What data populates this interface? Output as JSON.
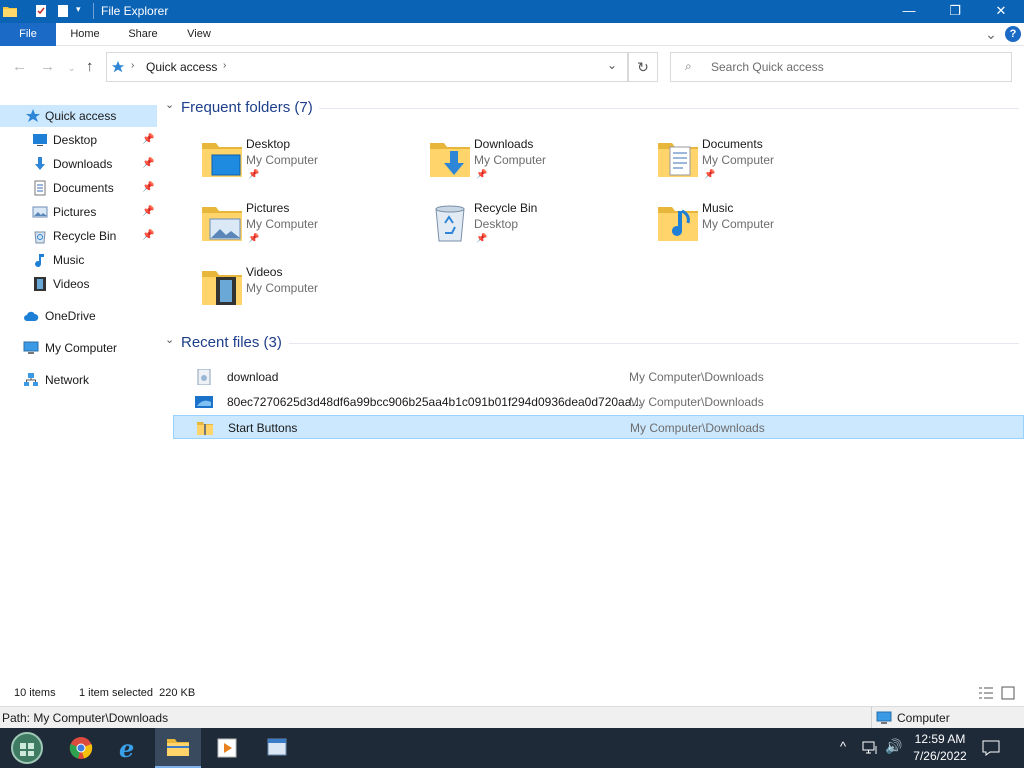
{
  "window": {
    "title": "File Explorer",
    "minimize": "—",
    "maximize": "❐",
    "close": "✕"
  },
  "ribbon": {
    "tabs": [
      "File",
      "Home",
      "Share",
      "View"
    ],
    "expand": "⌄",
    "help": "?"
  },
  "address": {
    "crumb": "Quick access",
    "search_placeholder": "Search Quick access"
  },
  "nav": {
    "items": [
      {
        "label": "Quick access"
      },
      {
        "label": "Desktop"
      },
      {
        "label": "Downloads"
      },
      {
        "label": "Documents"
      },
      {
        "label": "Pictures"
      },
      {
        "label": "Recycle Bin"
      },
      {
        "label": "Music"
      },
      {
        "label": "Videos"
      },
      {
        "label": "OneDrive"
      },
      {
        "label": "My Computer"
      },
      {
        "label": "Network"
      }
    ]
  },
  "frequent": {
    "header": "Frequent folders (7)",
    "tiles": [
      {
        "name": "Desktop",
        "location": "My Computer"
      },
      {
        "name": "Downloads",
        "location": "My Computer"
      },
      {
        "name": "Documents",
        "location": "My Computer"
      },
      {
        "name": "Pictures",
        "location": "My Computer"
      },
      {
        "name": "Recycle Bin",
        "location": "Desktop"
      },
      {
        "name": "Music",
        "location": "My Computer"
      },
      {
        "name": "Videos",
        "location": "My Computer"
      }
    ]
  },
  "recent": {
    "header": "Recent files (3)",
    "files": [
      {
        "name": "download",
        "path": "My Computer\\Downloads"
      },
      {
        "name": "80ec7270625d3d48df6a99bcc906b25aa4b1c091b01f294d0936dea0d720aa...",
        "path": "My Computer\\Downloads"
      },
      {
        "name": "Start Buttons",
        "path": "My Computer\\Downloads"
      }
    ]
  },
  "status": {
    "count": "10 items",
    "selected": "1 item selected  220 KB"
  },
  "pathbar": {
    "path": "Path: My Computer\\Downloads",
    "zone": "Computer"
  },
  "taskbar": {
    "time": "12:59 AM",
    "date": "7/26/2022"
  },
  "colors": {
    "titlebar": "#0b63b6",
    "accent": "#1b6ac5",
    "selection": "#cce8ff",
    "taskbar": "#1e2a38"
  }
}
